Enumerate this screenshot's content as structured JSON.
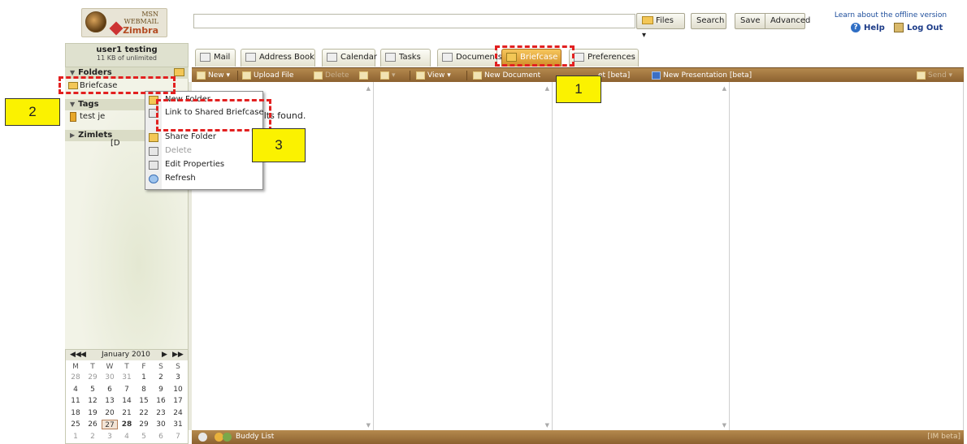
{
  "logo": {
    "line1": "MSN",
    "line2": "WEBMAIL",
    "line3": "Zimbra"
  },
  "header": {
    "search_value": "",
    "files_label": "Files ▾",
    "search_label": "Search",
    "save_label": "Save",
    "advanced_label": "Advanced",
    "offline_text": "Learn about the offline version",
    "help_label": "Help",
    "logout_label": "Log Out"
  },
  "user": {
    "name": "user1 testing",
    "quota": "11 KB of unlimited"
  },
  "sidebar": {
    "folders_label": "Folders",
    "briefcase_label": "Briefcase",
    "tags_label": "Tags",
    "tag_item": "test je",
    "zimlets_label": "Zimlets"
  },
  "tabs": [
    {
      "label": "Mail"
    },
    {
      "label": "Address Book"
    },
    {
      "label": "Calendar"
    },
    {
      "label": "Tasks"
    },
    {
      "label": "Documents"
    },
    {
      "label": "Briefcase"
    },
    {
      "label": "Preferences"
    }
  ],
  "toolbar": {
    "new_label": "New ▾",
    "upload_label": "Upload File",
    "delete_label": "Delete",
    "view_label": "View ▾",
    "new_document_label": "New Document",
    "spreadsheet_tail": "et [beta]",
    "new_presentation_label": "New Presentation [beta]",
    "send_label": "Send ▾"
  },
  "content": {
    "no_results_partial": "sults found."
  },
  "context_menu": {
    "new_folder": "New Folder",
    "link_shared": "Link to Shared Briefcase",
    "share_folder": "Share Folder",
    "delete": "Delete",
    "delete_key": "[D",
    "edit_properties": "Edit Properties",
    "refresh": "Refresh"
  },
  "calendar": {
    "prev2": "◀◀",
    "prev": "◀",
    "month": "January 2010",
    "next": "▶",
    "next2": "▶▶",
    "dow": [
      "M",
      "T",
      "W",
      "T",
      "F",
      "S",
      "S"
    ],
    "weeks": [
      [
        "28",
        "29",
        "30",
        "31",
        "1",
        "2",
        "3"
      ],
      [
        "4",
        "5",
        "6",
        "7",
        "8",
        "9",
        "10"
      ],
      [
        "11",
        "12",
        "13",
        "14",
        "15",
        "16",
        "17"
      ],
      [
        "18",
        "19",
        "20",
        "21",
        "22",
        "23",
        "24"
      ],
      [
        "25",
        "26",
        "27",
        "28",
        "29",
        "30",
        "31"
      ],
      [
        "1",
        "2",
        "3",
        "4",
        "5",
        "6",
        "7"
      ]
    ],
    "today": "27",
    "highlight": "28"
  },
  "bottom": {
    "buddy_list": "Buddy List",
    "im_beta": "[IM beta]"
  },
  "callouts": {
    "c1": "1",
    "c2": "2",
    "c3": "3"
  },
  "colors": {
    "accent": "#e22020",
    "callout": "#fbf200",
    "toolbar": "#9b6f3a",
    "active_tab": "#e3a13f"
  }
}
